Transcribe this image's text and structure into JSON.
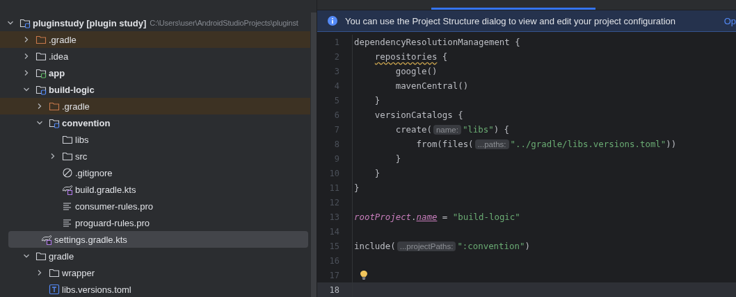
{
  "project_tree": {
    "root": {
      "label": "pluginstudy **[plugin study]**",
      "path": "C:\\Users\\user\\AndroidStudioProjects\\pluginst",
      "kind": "module",
      "expanded": true,
      "selected": false,
      "excluded": false,
      "children": [
        {
          "label": ".gradle",
          "kind": "folder",
          "expanded": false,
          "selected": false,
          "excluded": true
        },
        {
          "label": ".idea",
          "kind": "folder",
          "expanded": false,
          "selected": false,
          "excluded": false
        },
        {
          "label": "app",
          "kind": "app-module",
          "expanded": false,
          "selected": false,
          "excluded": false
        },
        {
          "label": "build-logic",
          "kind": "module",
          "expanded": true,
          "selected": false,
          "excluded": false,
          "children": [
            {
              "label": ".gradle",
              "kind": "folder",
              "expanded": false,
              "selected": false,
              "excluded": true
            },
            {
              "label": "convention",
              "kind": "module",
              "expanded": true,
              "selected": false,
              "excluded": false,
              "children": [
                {
                  "label": "libs",
                  "kind": "folder",
                  "selected": false,
                  "excluded": false
                },
                {
                  "label": "src",
                  "kind": "folder",
                  "expanded": false,
                  "selected": false,
                  "excluded": false
                },
                {
                  "label": ".gitignore",
                  "kind": "ignore",
                  "selected": false,
                  "excluded": false
                },
                {
                  "label": "build.gradle.kts",
                  "kind": "gradle",
                  "selected": false,
                  "excluded": false
                },
                {
                  "label": "consumer-rules.pro",
                  "kind": "text",
                  "selected": false,
                  "excluded": false
                },
                {
                  "label": "proguard-rules.pro",
                  "kind": "text",
                  "selected": false,
                  "excluded": false
                }
              ]
            },
            {
              "label": "settings.gradle.kts",
              "kind": "gradle",
              "selected": true,
              "excluded": false
            }
          ]
        },
        {
          "label": "gradle",
          "kind": "folder",
          "expanded": true,
          "selected": false,
          "excluded": false,
          "children": [
            {
              "label": "wrapper",
              "kind": "folder",
              "expanded": false,
              "selected": false,
              "excluded": false
            },
            {
              "label": "libs.versions.toml",
              "kind": "toml",
              "selected": false,
              "excluded": false
            }
          ]
        }
      ]
    }
  },
  "banner": {
    "message": "You can use the Project Structure dialog to view and edit your project configuration",
    "link": "Op"
  },
  "editor": {
    "lines": [
      {
        "number": "1",
        "current": false,
        "bulb": false,
        "tokens": [
          {
            "kind": "code",
            "text": "dependencyResolutionManagement {"
          }
        ]
      },
      {
        "number": "2",
        "current": false,
        "bulb": false,
        "tokens": [
          {
            "kind": "warning",
            "text": "repositories",
            "indented": true
          },
          {
            "kind": "code",
            "text": " {"
          }
        ]
      },
      {
        "number": "3",
        "current": false,
        "bulb": false,
        "tokens": [
          {
            "kind": "code",
            "text": "        google()"
          }
        ]
      },
      {
        "number": "4",
        "current": false,
        "bulb": false,
        "tokens": [
          {
            "kind": "code",
            "text": "        mavenCentral()"
          }
        ]
      },
      {
        "number": "5",
        "current": false,
        "bulb": false,
        "tokens": [
          {
            "kind": "code",
            "text": "    }"
          }
        ]
      },
      {
        "number": "6",
        "current": false,
        "bulb": false,
        "tokens": [
          {
            "kind": "code",
            "text": "    versionCatalogs {"
          }
        ]
      },
      {
        "number": "7",
        "current": false,
        "bulb": false,
        "tokens": [
          {
            "kind": "code",
            "text": "        create("
          },
          {
            "kind": "hint",
            "text": "name:"
          },
          {
            "kind": "string",
            "text": "\"libs\""
          },
          {
            "kind": "code",
            "text": ") {"
          }
        ]
      },
      {
        "number": "8",
        "current": false,
        "bulb": false,
        "tokens": [
          {
            "kind": "code",
            "text": "            from(files("
          },
          {
            "kind": "hint",
            "text": "...paths:"
          },
          {
            "kind": "string",
            "text": "\"../gradle/libs.versions.toml\""
          },
          {
            "kind": "code",
            "text": "))"
          }
        ]
      },
      {
        "number": "9",
        "current": false,
        "bulb": false,
        "tokens": [
          {
            "kind": "code",
            "text": "        }"
          }
        ]
      },
      {
        "number": "10",
        "current": false,
        "bulb": false,
        "tokens": [
          {
            "kind": "code",
            "text": "    }"
          }
        ]
      },
      {
        "number": "11",
        "current": false,
        "bulb": false,
        "tokens": [
          {
            "kind": "code",
            "text": "}"
          }
        ]
      },
      {
        "number": "12",
        "current": false,
        "bulb": false
      },
      {
        "number": "13",
        "current": false,
        "bulb": false,
        "tokens": [
          {
            "kind": "property",
            "text": "rootProject"
          },
          {
            "kind": "code",
            "text": "."
          },
          {
            "kind": "property-link",
            "text": "name"
          },
          {
            "kind": "code",
            "text": " = "
          },
          {
            "kind": "string",
            "text": "\"build-logic\""
          }
        ]
      },
      {
        "number": "14",
        "current": false,
        "bulb": false
      },
      {
        "number": "15",
        "current": false,
        "bulb": false,
        "tokens": [
          {
            "kind": "code",
            "text": "include("
          },
          {
            "kind": "hint",
            "text": "...projectPaths:"
          },
          {
            "kind": "string",
            "text": "\":convention\""
          },
          {
            "kind": "code",
            "text": ")"
          }
        ]
      },
      {
        "number": "16",
        "current": false,
        "bulb": false
      },
      {
        "number": "17",
        "current": false,
        "bulb": true
      },
      {
        "number": "18",
        "current": true,
        "bulb": false
      }
    ]
  }
}
